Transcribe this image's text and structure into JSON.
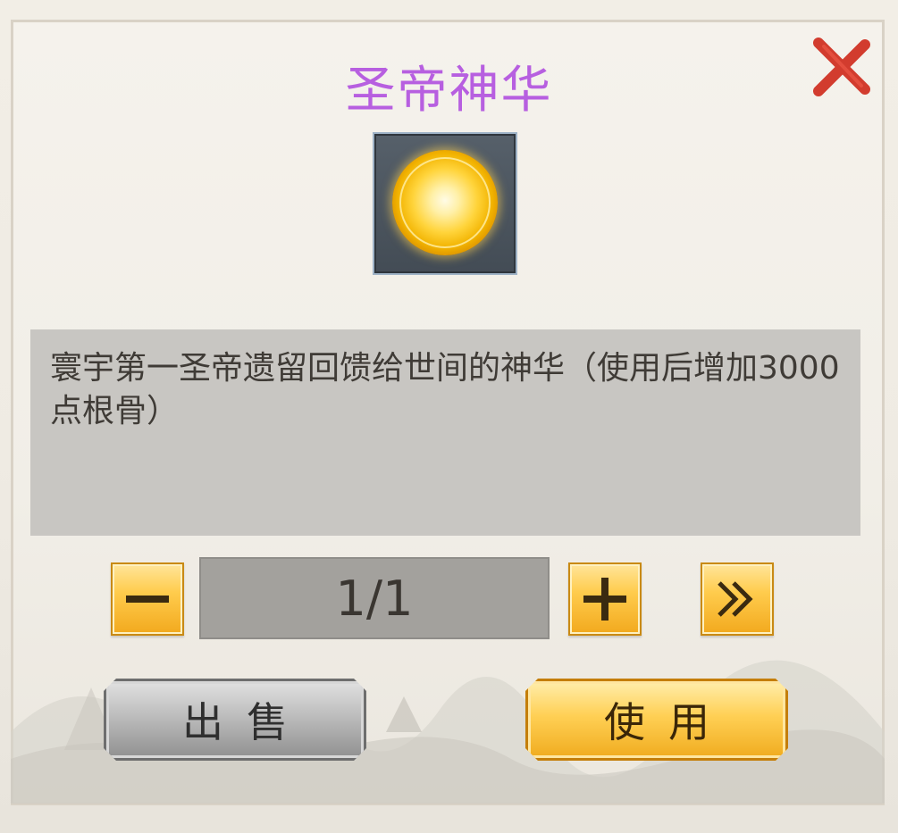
{
  "dialog": {
    "title": "圣帝神华",
    "title_color": "#b75fe0",
    "close_icon": "close-icon",
    "item_icon": "golden-orb-icon",
    "description": "寰宇第一圣帝遗留回馈给世间的神华（使用后增加3000点根骨）"
  },
  "quantity": {
    "decrease_icon": "minus-icon",
    "value": "1/1",
    "increase_icon": "plus-icon",
    "max_icon": "double-chevron-right-icon"
  },
  "actions": {
    "sell_label": "出售",
    "use_label": "使用"
  }
}
